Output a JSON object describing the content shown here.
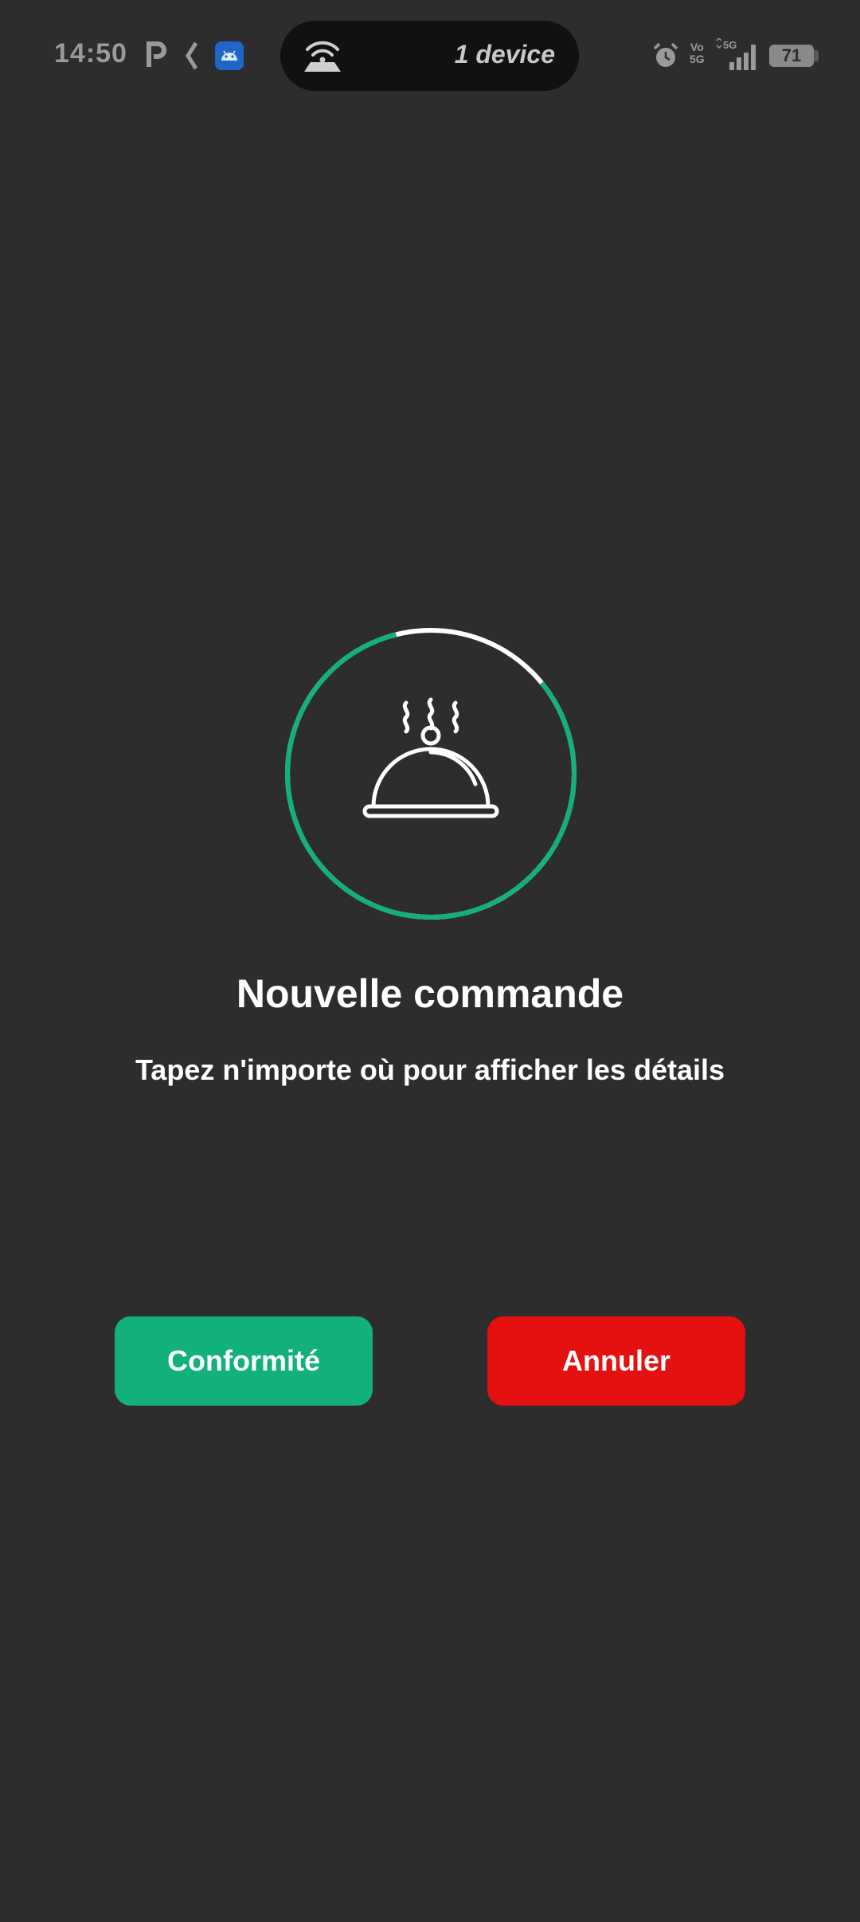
{
  "status_bar": {
    "time": "14:50",
    "hotspot_text": "1 device",
    "battery_level": "71",
    "network_label": "5G",
    "volte_label_top": "Vo",
    "volte_label_bottom": "5G"
  },
  "icons": {
    "notification_p": "parking-p-icon",
    "notification_k": "k-app-icon",
    "notification_android": "android-icon",
    "hotspot": "hotspot-icon",
    "alarm": "alarm-icon",
    "signal": "signal-icon",
    "battery": "battery-icon",
    "main": "food-cloche-icon"
  },
  "order_alert": {
    "countdown_progress_remaining": 0.82,
    "title": "Nouvelle commande",
    "subtitle": "Tapez n'importe où pour afficher les détails"
  },
  "actions": {
    "confirm_label": "Conformité",
    "cancel_label": "Annuler"
  },
  "colors": {
    "background": "#2d2d2d",
    "accent_green": "#12b07a",
    "danger_red": "#e51010",
    "text": "#ffffff"
  }
}
